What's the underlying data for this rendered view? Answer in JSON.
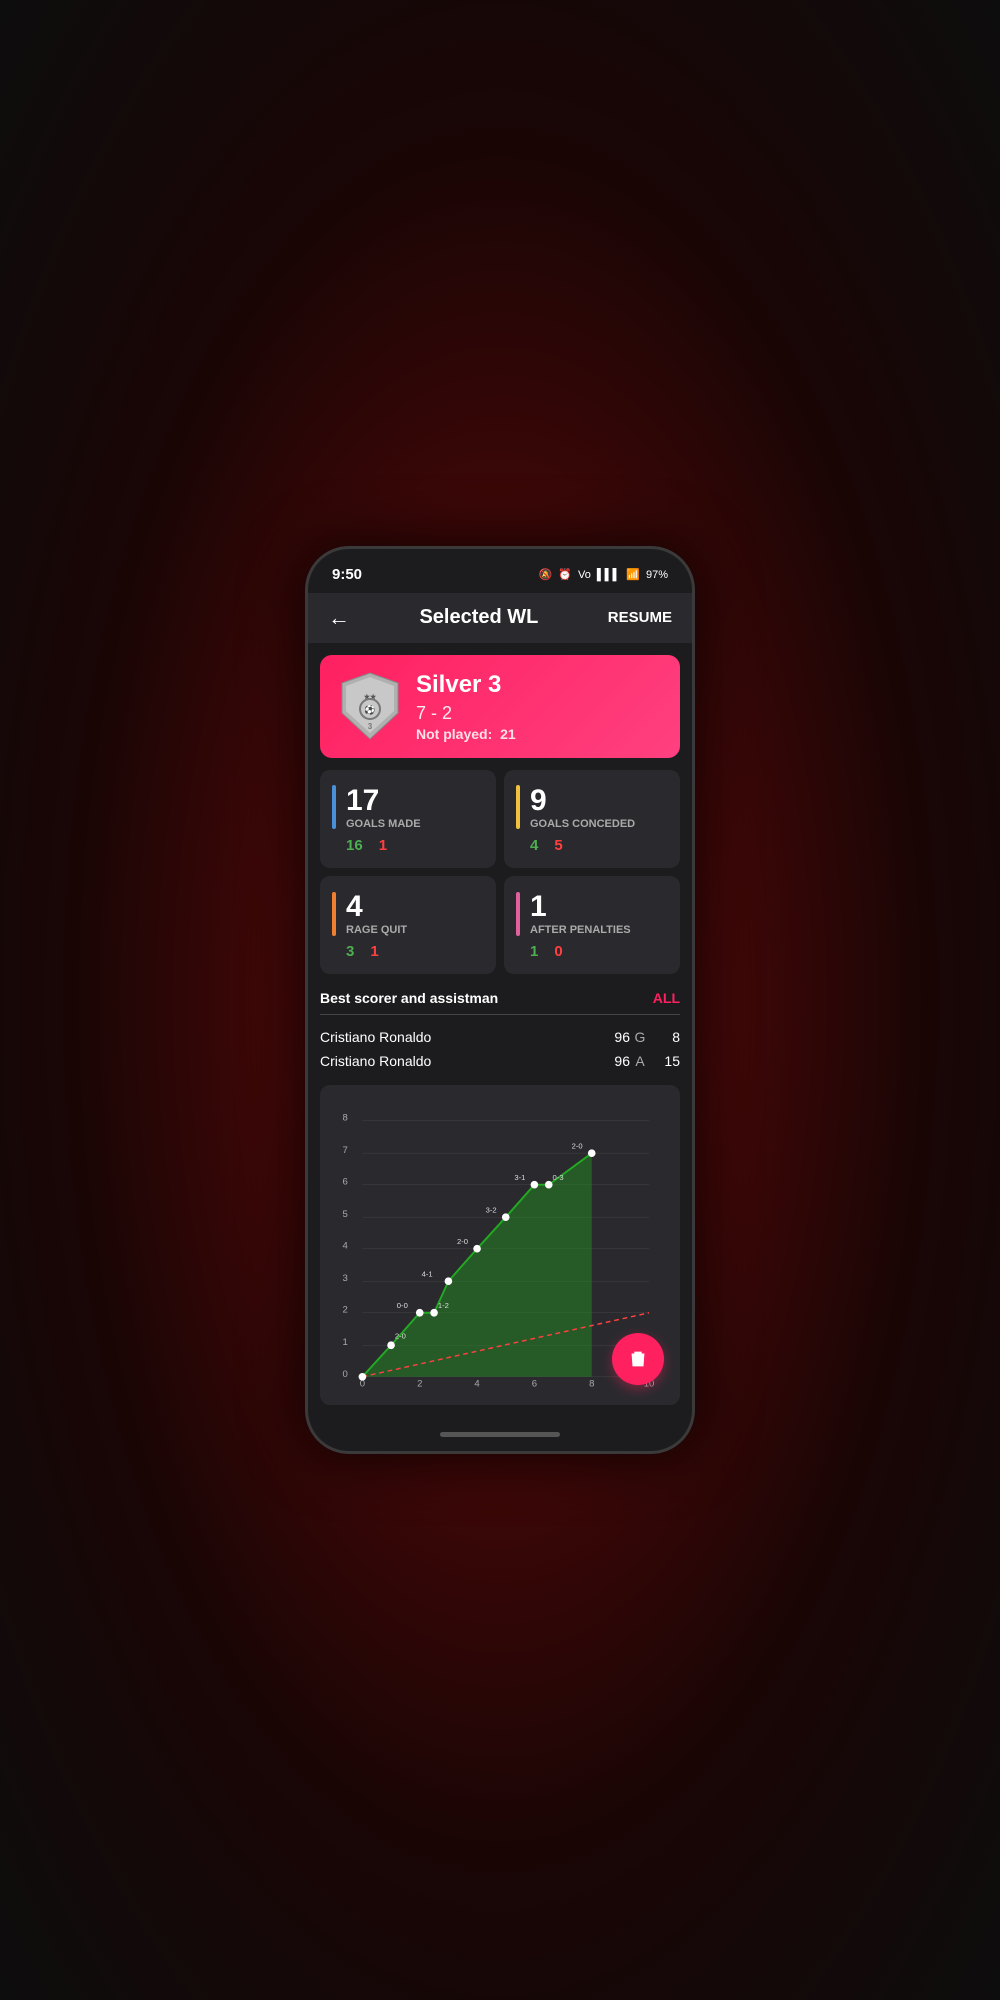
{
  "status_bar": {
    "time": "9:50",
    "battery": "97"
  },
  "header": {
    "back_label": "←",
    "title": "Selected WL",
    "resume_label": "RESUME"
  },
  "rank_card": {
    "rank_name": "Silver 3",
    "score": "7 - 2",
    "not_played_label": "Not played:",
    "not_played_value": "21"
  },
  "stats": [
    {
      "id": "goals-made",
      "bar_color": "blue",
      "number": "17",
      "label": "GOALS MADE",
      "win": "16",
      "loss": "1"
    },
    {
      "id": "goals-conceded",
      "bar_color": "yellow",
      "number": "9",
      "label": "GOALS CONCEDED",
      "win": "4",
      "loss": "5"
    },
    {
      "id": "rage-quit",
      "bar_color": "orange",
      "number": "4",
      "label": "RAGE QUIT",
      "win": "3",
      "loss": "1"
    },
    {
      "id": "after-penalties",
      "bar_color": "pink",
      "number": "1",
      "label": "AFTER PENALTIES",
      "win": "1",
      "loss": "0"
    }
  ],
  "best_scorer_section": {
    "title": "Best scorer and assistman",
    "all_label": "ALL"
  },
  "players": [
    {
      "name": "Cristiano Ronaldo",
      "rating": "96",
      "type": "G",
      "value": "8"
    },
    {
      "name": "Cristiano Ronaldo",
      "rating": "96",
      "type": "A",
      "value": "15"
    }
  ],
  "chart": {
    "y_labels": [
      "0",
      "1",
      "2",
      "3",
      "4",
      "5",
      "6",
      "7",
      "8"
    ],
    "x_labels": [
      "0",
      "2",
      "4",
      "6",
      "8",
      "10"
    ],
    "green_points": [
      {
        "x": 0,
        "y": 0,
        "label": ""
      },
      {
        "x": 1,
        "y": 1,
        "label": "2-0"
      },
      {
        "x": 2,
        "y": 2,
        "label": "0-0"
      },
      {
        "x": 2.5,
        "y": 2,
        "label": "1-2"
      },
      {
        "x": 3,
        "y": 3,
        "label": "4-1"
      },
      {
        "x": 4,
        "y": 4,
        "label": "2-0"
      },
      {
        "x": 5,
        "y": 5,
        "label": "3-2"
      },
      {
        "x": 6,
        "y": 6,
        "label": "3-1"
      },
      {
        "x": 6.5,
        "y": 6,
        "label": "0-3"
      },
      {
        "x": 8,
        "y": 7,
        "label": "2-0"
      }
    ]
  },
  "fab": {
    "icon": "🗑",
    "label": "delete"
  }
}
